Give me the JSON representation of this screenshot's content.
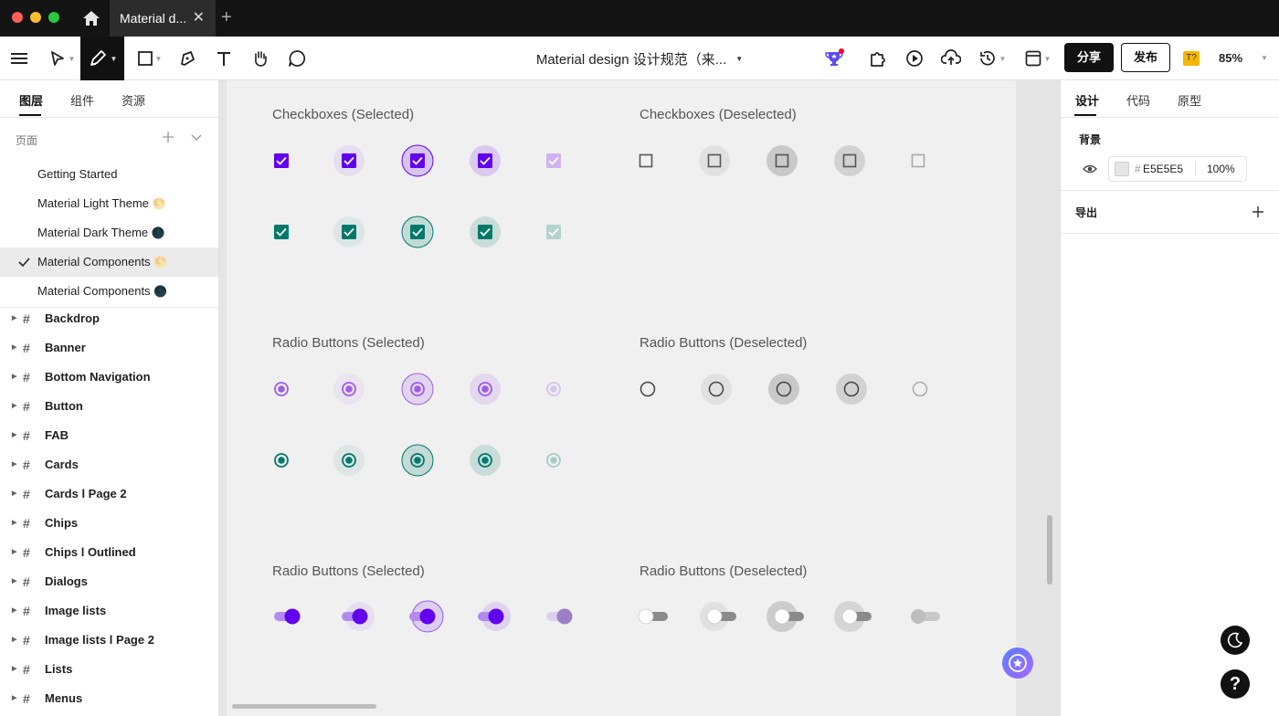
{
  "window": {
    "tab_title": "Material d...",
    "close_glyph": "✕",
    "new_tab_glyph": "+"
  },
  "toolbar": {
    "file_title": "Material design 设计规范（来...",
    "share_label": "分享",
    "publish_label": "发布",
    "plugin_badge": "T?",
    "zoom": "85%"
  },
  "left_panel": {
    "tabs": [
      "图层",
      "组件",
      "资源"
    ],
    "pages_label": "页面",
    "pages": [
      {
        "label": "Getting Started",
        "emoji": ""
      },
      {
        "label": "Material Light Theme",
        "emoji": "🌕"
      },
      {
        "label": "Material Dark Theme",
        "emoji": "🌑"
      },
      {
        "label": "Material Components",
        "emoji": "🌕"
      },
      {
        "label": "Material Components",
        "emoji": "🌑"
      }
    ],
    "selected_page_index": 3,
    "layers": [
      "Backdrop",
      "Banner",
      "Bottom Navigation",
      "Button",
      "FAB",
      "Cards",
      "Cards l Page 2",
      "Chips",
      "Chips l Outlined",
      "Dialogs",
      "Image lists",
      "Image lists l Page 2",
      "Lists",
      "Menus"
    ]
  },
  "canvas": {
    "sections": [
      "Checkboxes (Selected)",
      "Checkboxes (Deselected)",
      "Radio Buttons (Selected)",
      "Radio Buttons (Deselected)",
      "Radio Buttons (Selected)",
      "Radio Buttons (Deselected)"
    ],
    "colors": {
      "primary": "#6200EE",
      "secondary": "#00796B",
      "unselected": "#616161",
      "canvas_bg": "#F0F0F0"
    }
  },
  "right_panel": {
    "tabs": [
      "设计",
      "代码",
      "原型"
    ],
    "background_label": "背景",
    "background_hash": "#",
    "background_hex": "E5E5E5",
    "background_opacity": "100%",
    "export_label": "导出"
  },
  "icons": [
    "menu-icon",
    "move-tool-icon",
    "pen-tool-icon",
    "rectangle-tool-icon",
    "pencil-tool-icon",
    "text-tool-icon",
    "hand-tool-icon",
    "comment-tool-icon",
    "trophy-icon",
    "plugin-icon",
    "play-icon",
    "upload-icon",
    "history-icon",
    "layout-icon",
    "eye-icon",
    "plus-icon",
    "dark-mode-icon",
    "help-icon",
    "ai-assistant-icon"
  ]
}
